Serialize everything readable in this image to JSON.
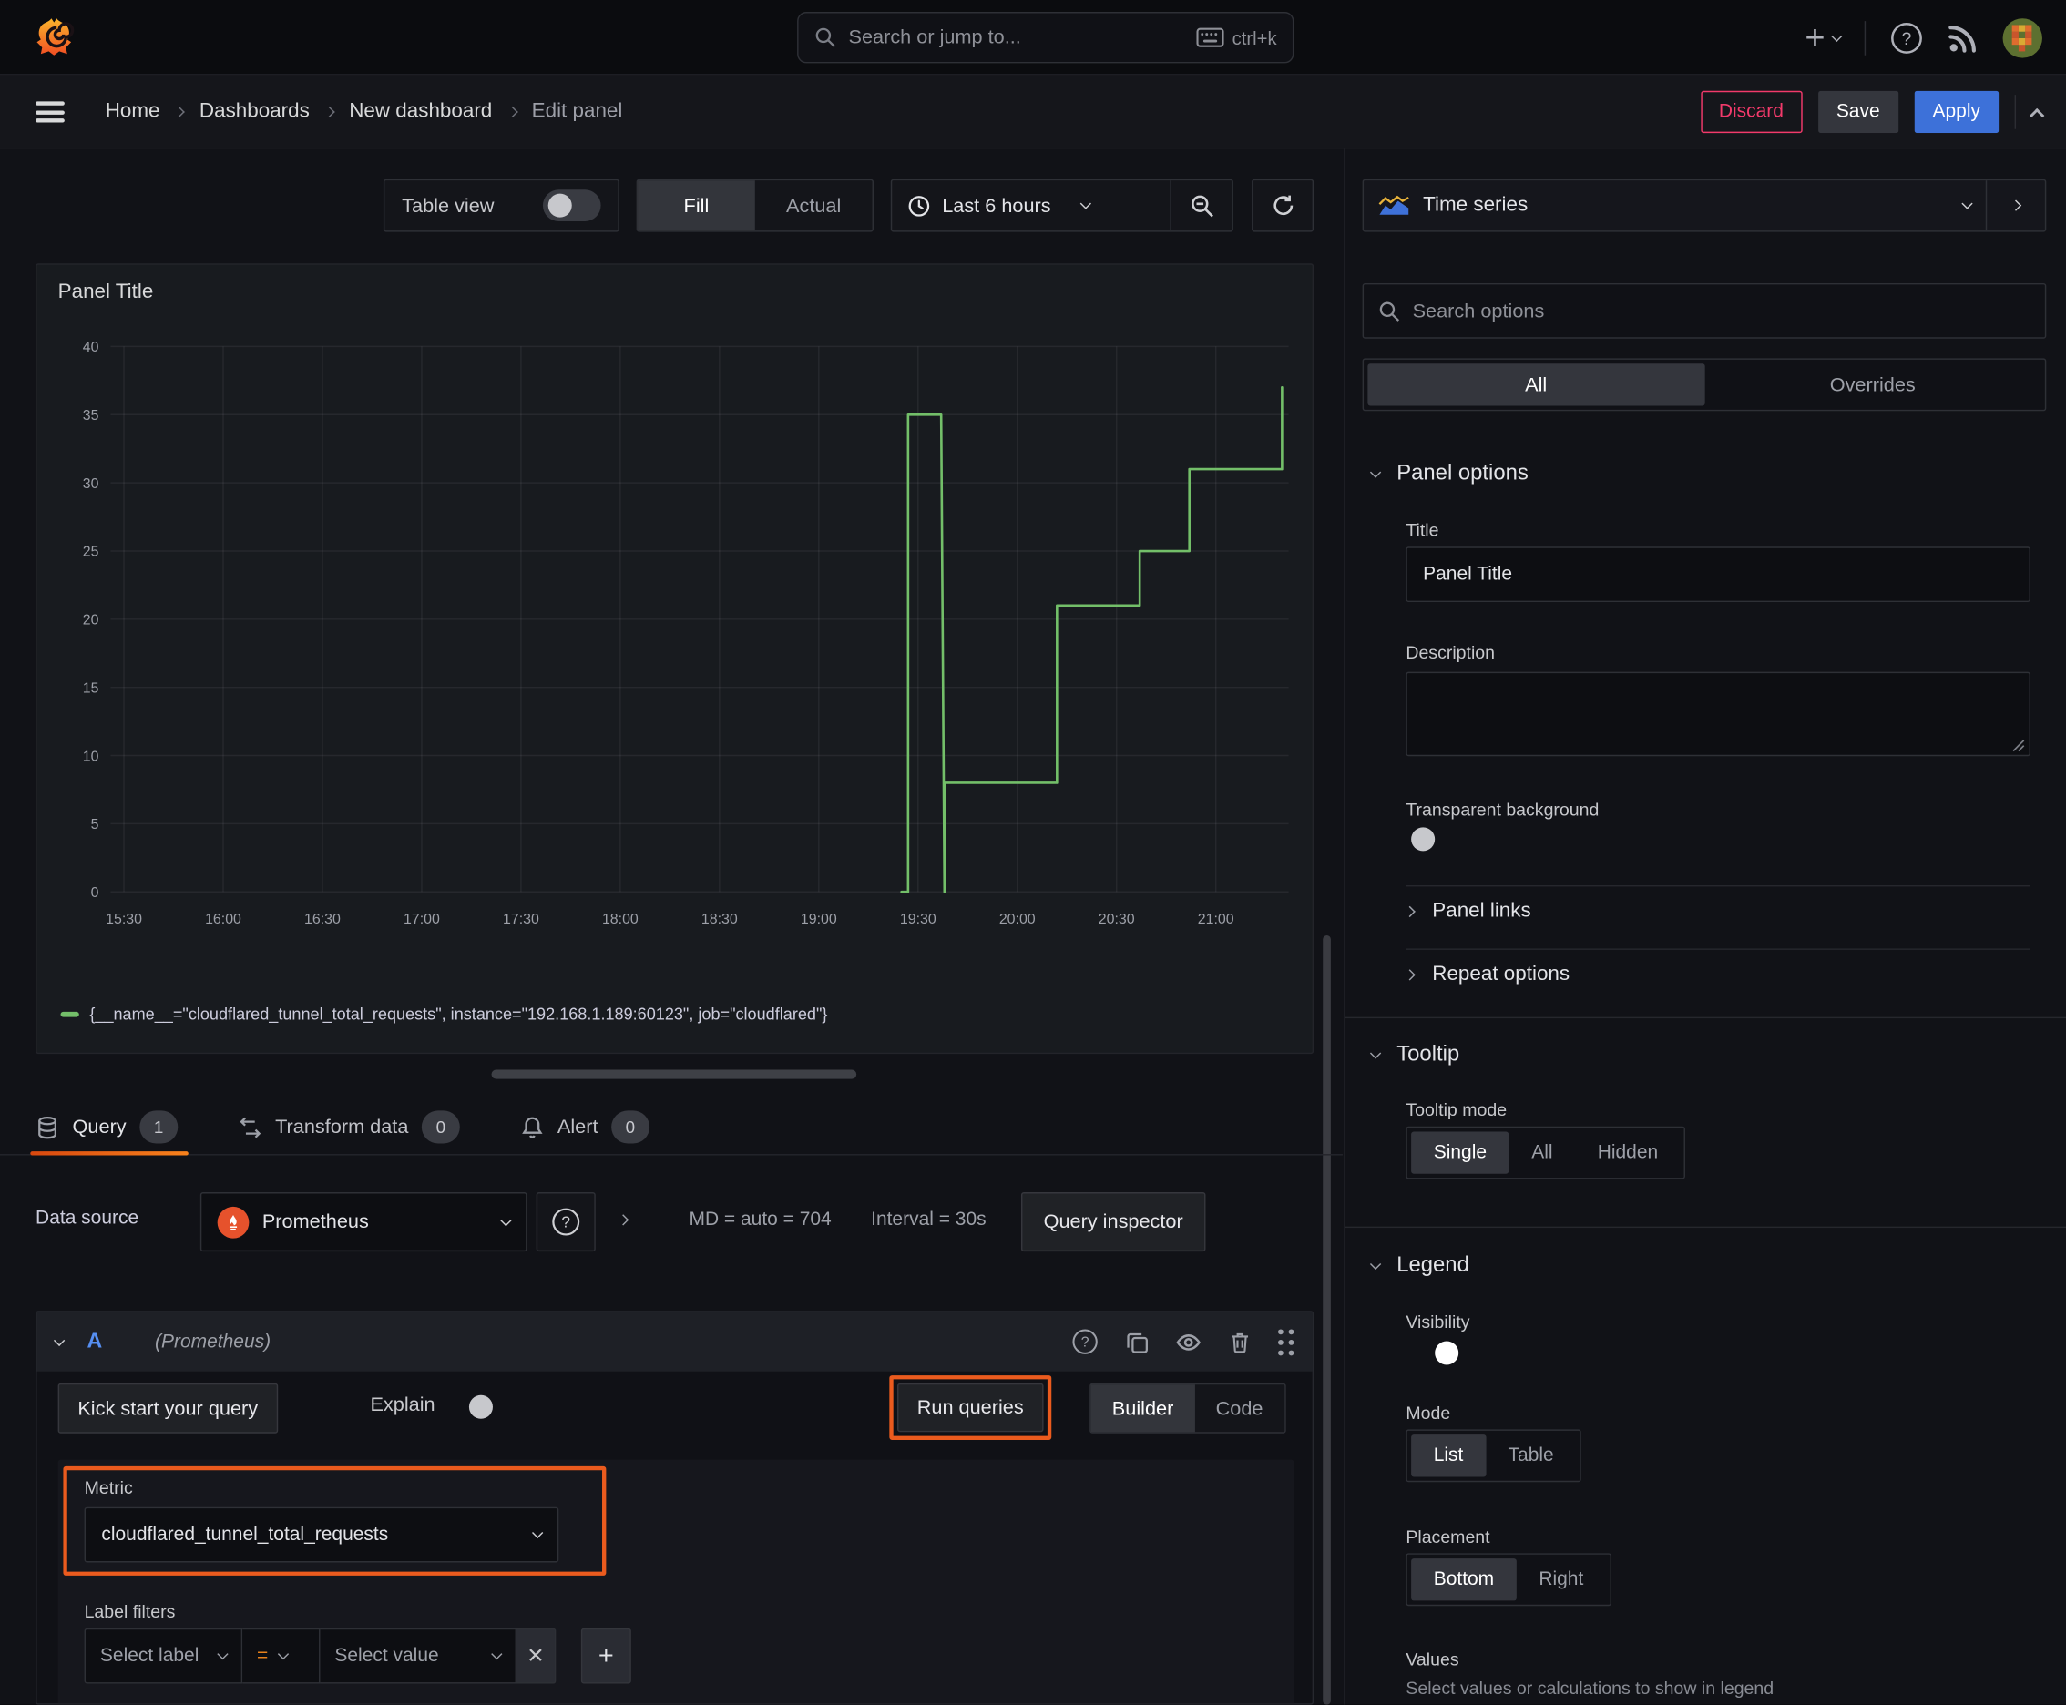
{
  "colors": {
    "accent_orange": "#eb5b1e",
    "series_green": "#73bf69",
    "primary_blue": "#3d71d9",
    "danger_pink": "#f23a6b"
  },
  "topbar": {
    "search_placeholder": "Search or jump to...",
    "search_shortcut": "ctrl+k"
  },
  "breadcrumb": {
    "items": [
      "Home",
      "Dashboards",
      "New dashboard",
      "Edit panel"
    ],
    "separator": "›",
    "discard_label": "Discard",
    "save_label": "Save",
    "apply_label": "Apply"
  },
  "panel_toolbar": {
    "table_view_label": "Table view",
    "fill_label": "Fill",
    "actual_label": "Actual",
    "time_range_label": "Last 6 hours"
  },
  "panel": {
    "title": "Panel Title",
    "legend_label": "{__name__=\"cloudflared_tunnel_total_requests\", instance=\"192.168.1.189:60123\", job=\"cloudflared\"}"
  },
  "chart_data": {
    "type": "line",
    "line_style": "step",
    "title": "Panel Title",
    "xlabel": "",
    "ylabel": "",
    "x_range": [
      "15:26",
      "21:22"
    ],
    "ylim": [
      0,
      40
    ],
    "x_ticks": [
      "15:30",
      "16:00",
      "16:30",
      "17:00",
      "17:30",
      "18:00",
      "18:30",
      "19:00",
      "19:30",
      "20:00",
      "20:30",
      "21:00"
    ],
    "y_ticks": [
      0,
      5,
      10,
      15,
      20,
      25,
      30,
      35,
      40
    ],
    "grid": true,
    "legend_position": "bottom",
    "series": [
      {
        "name": "{__name__=\"cloudflared_tunnel_total_requests\", instance=\"192.168.1.189:60123\", job=\"cloudflared\"}",
        "color": "#73bf69",
        "points": [
          [
            "19:25",
            0
          ],
          [
            "19:27",
            0
          ],
          [
            "19:27",
            35
          ],
          [
            "19:37",
            35
          ],
          [
            "19:38",
            0
          ],
          [
            "19:38",
            8
          ],
          [
            "20:12",
            8
          ],
          [
            "20:12",
            21
          ],
          [
            "20:37",
            21
          ],
          [
            "20:37",
            25
          ],
          [
            "20:52",
            25
          ],
          [
            "20:52",
            31
          ],
          [
            "21:20",
            31
          ],
          [
            "21:20",
            37
          ]
        ]
      }
    ]
  },
  "query_tabs": {
    "query": {
      "label": "Query",
      "count": "1"
    },
    "transform": {
      "label": "Transform data",
      "count": "0"
    },
    "alert": {
      "label": "Alert",
      "count": "0"
    }
  },
  "datasource_bar": {
    "label": "Data source",
    "selected": "Prometheus",
    "stat_md": "MD = auto = 704",
    "stat_interval": "Interval = 30s",
    "query_inspector_label": "Query inspector"
  },
  "query_row": {
    "ref_id": "A",
    "ds_name": "(Prometheus)"
  },
  "query_editor": {
    "kick_start_label": "Kick start your query",
    "explain_label": "Explain",
    "run_queries_label": "Run queries",
    "builder_label": "Builder",
    "code_label": "Code",
    "metric_label": "Metric",
    "metric_value": "cloudflared_tunnel_total_requests",
    "label_filters_label": "Label filters",
    "select_label_placeholder": "Select label",
    "operator_value": "=",
    "select_value_placeholder": "Select value",
    "remove_filter_label": "✕",
    "add_filter_label": "+"
  },
  "sidebar": {
    "visualization": "Time series",
    "search_placeholder": "Search options",
    "tabs": {
      "all": "All",
      "overrides": "Overrides"
    },
    "panel_options": {
      "heading": "Panel options",
      "title_label": "Title",
      "title_value": "Panel Title",
      "description_label": "Description",
      "transparent_label": "Transparent background"
    },
    "panel_links_heading": "Panel links",
    "repeat_options_heading": "Repeat options",
    "tooltip": {
      "heading": "Tooltip",
      "mode_label": "Tooltip mode",
      "options": [
        "Single",
        "All",
        "Hidden"
      ]
    },
    "legend": {
      "heading": "Legend",
      "visibility_label": "Visibility",
      "mode_label": "Mode",
      "mode_options": [
        "List",
        "Table"
      ],
      "placement_label": "Placement",
      "placement_options": [
        "Bottom",
        "Right"
      ],
      "values_label": "Values",
      "values_hint": "Select values or calculations to show in legend"
    }
  }
}
